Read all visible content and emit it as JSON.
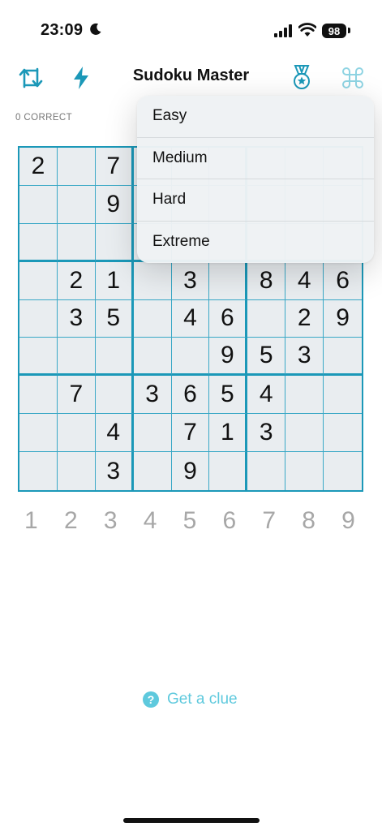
{
  "status_bar": {
    "time": "23:09",
    "battery": "98"
  },
  "header": {
    "title": "Sudoku Master",
    "icons": [
      "refresh-icon",
      "lightning-icon",
      "medal-icon",
      "command-icon"
    ]
  },
  "correct_count": "0 CORRECT",
  "colors": {
    "accent": "#1b98b8",
    "cell_bg": "#e9edf0",
    "clue": "#5ec9dd",
    "numpad": "#a7a7a7"
  },
  "board": {
    "rows": [
      [
        "2",
        "",
        "7",
        "",
        "",
        "",
        "",
        "",
        ""
      ],
      [
        "",
        "",
        "9",
        "",
        "",
        "",
        "",
        "",
        ""
      ],
      [
        "",
        "",
        "",
        "",
        "",
        "",
        "",
        "",
        ""
      ],
      [
        "",
        "2",
        "1",
        "",
        "3",
        "",
        "8",
        "4",
        "6"
      ],
      [
        "",
        "3",
        "5",
        "",
        "4",
        "6",
        "",
        "2",
        "9"
      ],
      [
        "",
        "",
        "",
        "",
        "",
        "9",
        "5",
        "3",
        ""
      ],
      [
        "",
        "7",
        "",
        "3",
        "6",
        "5",
        "4",
        "",
        ""
      ],
      [
        "",
        "",
        "4",
        "",
        "7",
        "1",
        "3",
        "",
        ""
      ],
      [
        "",
        "",
        "3",
        "",
        "9",
        "",
        "",
        "",
        ""
      ]
    ]
  },
  "numpad": [
    "1",
    "2",
    "3",
    "4",
    "5",
    "6",
    "7",
    "8",
    "9"
  ],
  "difficulty_menu": {
    "items": [
      "Easy",
      "Medium",
      "Hard",
      "Extreme"
    ]
  },
  "clue": {
    "label": "Get a clue",
    "icon_text": "?"
  }
}
